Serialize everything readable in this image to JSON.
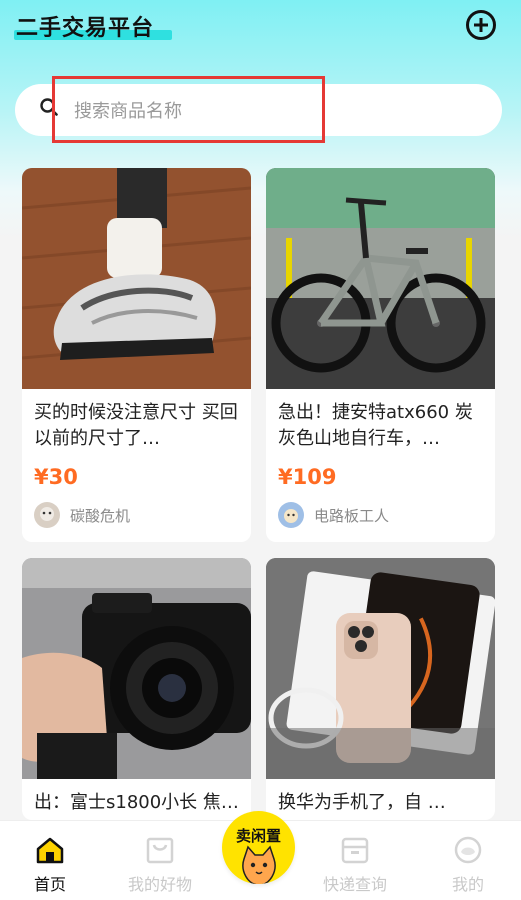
{
  "header": {
    "title": "二手交易平台",
    "add_icon": "plus-circle-icon"
  },
  "search": {
    "placeholder": "搜索商品名称",
    "icon": "search-icon"
  },
  "products": [
    {
      "title": "买的时候没注意尺寸 买回以前的尺寸了…",
      "price": "¥30",
      "seller": "碳酸危机",
      "image": "sneakers-photo"
    },
    {
      "title": "急出！捷安特atx660 炭灰色山地自行车，…",
      "price": "¥109",
      "seller": "电路板工人",
      "image": "mountain-bike-photo"
    },
    {
      "title": "出：富士s1800小长 焦…",
      "image": "camera-photo"
    },
    {
      "title": "换华为手机了，自 …",
      "image": "phone-photo"
    }
  ],
  "tabbar": {
    "tabs": [
      {
        "label": "首页",
        "icon": "home-icon",
        "active": true
      },
      {
        "label": "我的好物",
        "icon": "bag-icon"
      },
      {
        "label": "快递查询",
        "icon": "package-icon"
      },
      {
        "label": "我的",
        "icon": "profile-icon"
      }
    ],
    "sell_label": "卖闲置"
  },
  "colors": {
    "accent_cyan": "#2fe0e0",
    "price_orange": "#ff6b22",
    "sell_yellow": "#ffe300",
    "highlight_red": "#e53935"
  }
}
